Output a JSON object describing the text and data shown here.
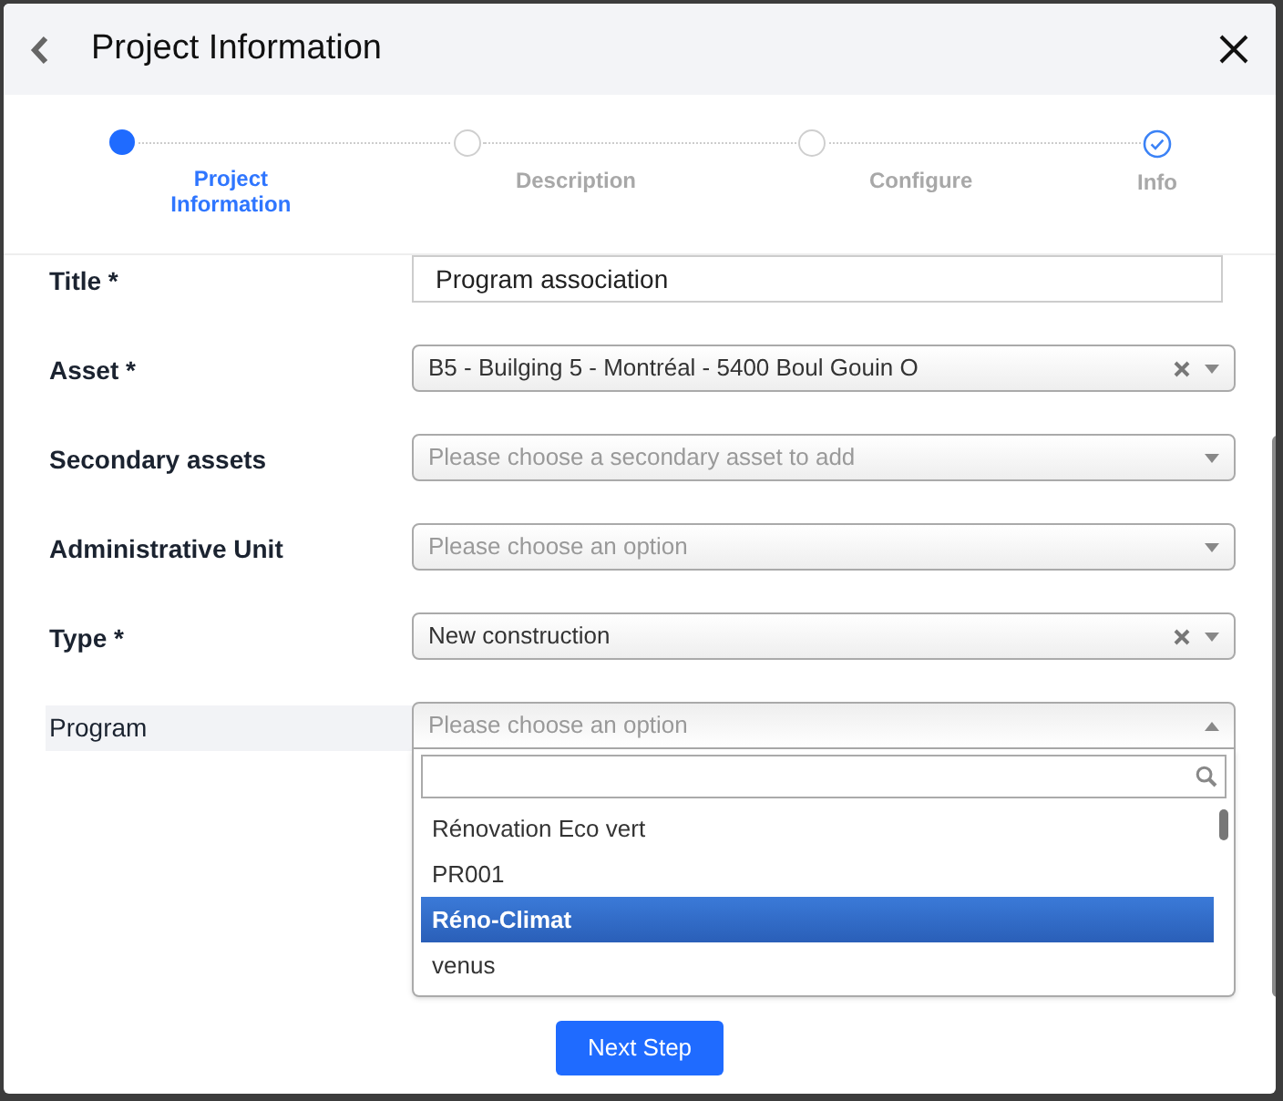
{
  "window": {
    "title": "Project Information"
  },
  "steps": [
    {
      "label": "Project Information",
      "kind": "current"
    },
    {
      "label": "Description",
      "kind": "pending"
    },
    {
      "label": "Configure",
      "kind": "pending"
    },
    {
      "label": "Info",
      "kind": "completed"
    }
  ],
  "fields": [
    {
      "kind": "text",
      "label": "Title *",
      "value": "Program association"
    },
    {
      "kind": "select",
      "label": "Asset *",
      "value": "B5 - Builging 5 - Montréal - 5400 Boul Gouin O",
      "clearable": true,
      "open": false,
      "highlighted": false
    },
    {
      "kind": "select",
      "label": "Secondary assets",
      "placeholder": "Please choose a secondary asset to add",
      "clearable": false,
      "open": false,
      "highlighted": false
    },
    {
      "kind": "select",
      "label": "Administrative Unit",
      "placeholder": "Please choose an option",
      "clearable": false,
      "open": false,
      "highlighted": false
    },
    {
      "kind": "select",
      "label": "Type *",
      "value": "New construction",
      "clearable": true,
      "open": false,
      "highlighted": false
    },
    {
      "kind": "select",
      "label": "Program",
      "placeholder": "Please choose an option",
      "clearable": false,
      "open": true,
      "highlighted": true,
      "options": [
        {
          "label": "Rénovation Eco vert",
          "selected": false
        },
        {
          "label": "PR001",
          "selected": false
        },
        {
          "label": "Réno-Climat",
          "selected": true
        },
        {
          "label": "venus",
          "selected": false
        }
      ]
    }
  ],
  "next_button": "Next Step"
}
